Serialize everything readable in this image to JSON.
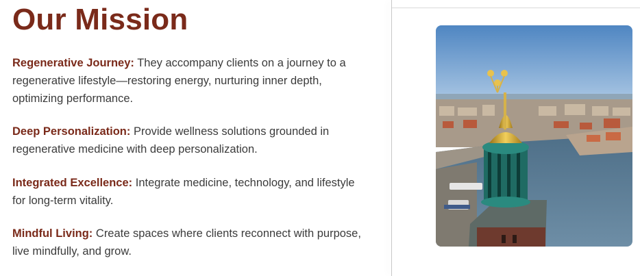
{
  "mission": {
    "title": "Our Mission",
    "items": [
      {
        "label": "Regenerative Journey:",
        "text": " They accompany clients on a journey to a regenerative lifestyle—restoring energy, nurturing inner depth, optimizing performance."
      },
      {
        "label": "Deep Personalization:",
        "text": " Provide wellness solutions grounded in regenerative medicine with deep personalization."
      },
      {
        "label": "Integrated Excellence:",
        "text": " Integrate medicine, technology, and lifestyle for long-term vitality."
      },
      {
        "label": "Mindful Living:",
        "text": " Create spaces where clients reconnect with purpose, live mindfully, and grow."
      }
    ]
  },
  "image": {
    "subject": "aerial-city-tower-photo"
  },
  "colors": {
    "accent": "#7a2a1a",
    "body_text": "#3b3b3b"
  }
}
